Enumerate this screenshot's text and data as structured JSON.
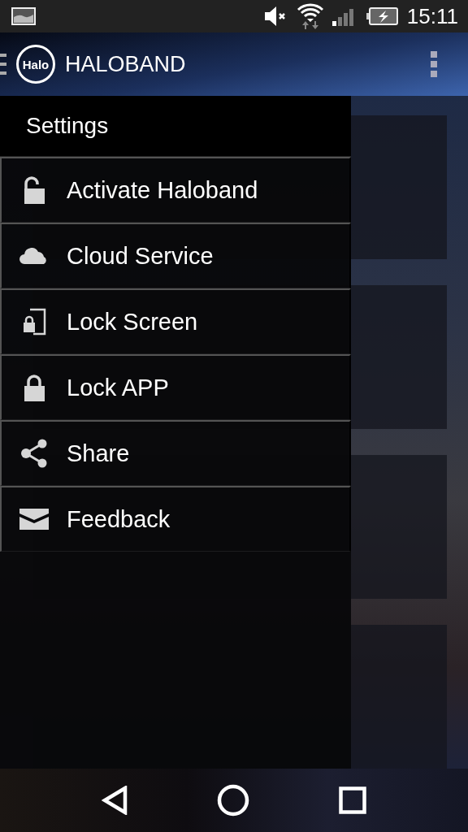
{
  "status_bar": {
    "time": "15:11"
  },
  "app_bar": {
    "logo_text": "Halo",
    "title": "HALOBAND"
  },
  "drawer": {
    "title": "Settings",
    "items": [
      {
        "label": "Activate Haloband"
      },
      {
        "label": "Cloud Service"
      },
      {
        "label": "Lock Screen"
      },
      {
        "label": "Lock APP"
      },
      {
        "label": "Share"
      },
      {
        "label": "Feedback"
      }
    ]
  }
}
